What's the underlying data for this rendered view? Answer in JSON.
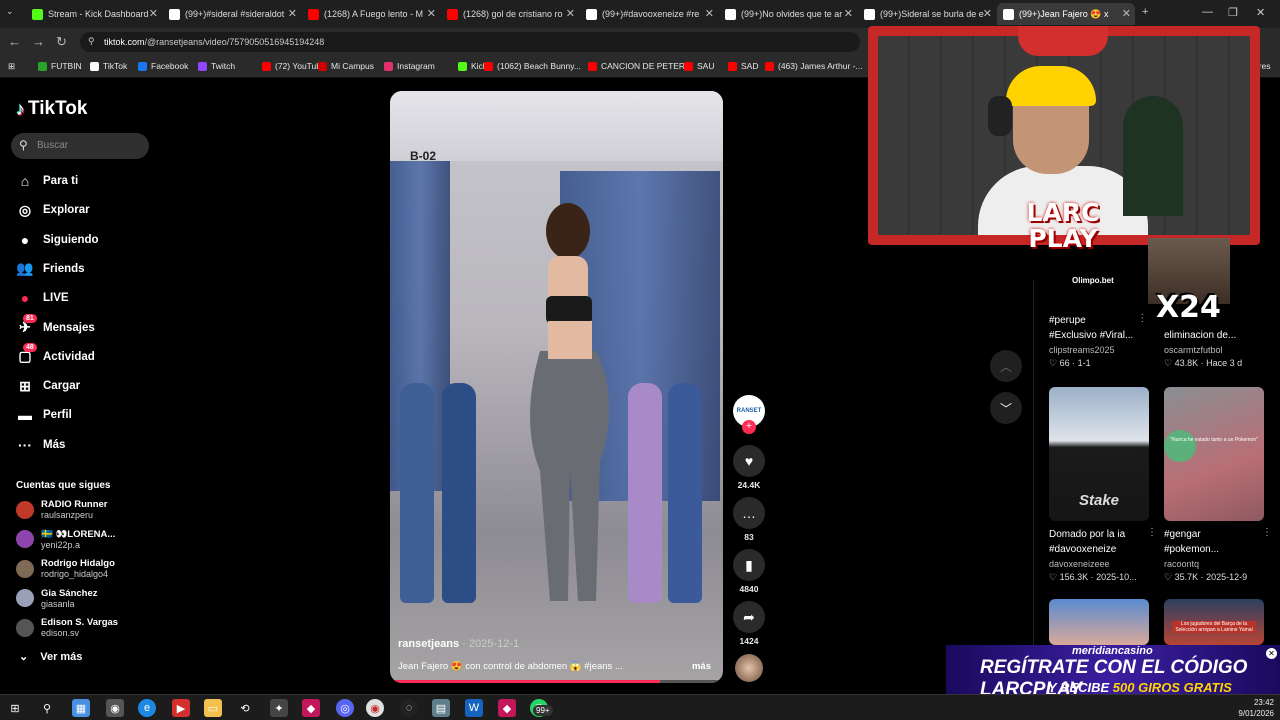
{
  "browser": {
    "tabs": [
      {
        "title": "Stream - Kick Dashboard",
        "fav": "#53fc18"
      },
      {
        "title": "(99+)#sideral #sideraldot",
        "fav": "#fff"
      },
      {
        "title": "(1268) A Fuego lento - M",
        "fav": "#ff0000"
      },
      {
        "title": "(1268) gol de cristiano ro",
        "fav": "#ff0000"
      },
      {
        "title": "(99+)#davooxeneize #re",
        "fav": "#fff"
      },
      {
        "title": "(99+)No olvides que te ar",
        "fav": "#fff"
      },
      {
        "title": "(99+)Sideral se burla de e",
        "fav": "#fff"
      },
      {
        "title": "(99+)Jean Fajero 😍 x",
        "fav": "#fff",
        "active": true
      }
    ],
    "new_tab": "+",
    "url_host": "tiktok.com",
    "url_path": "/@ransetjeans/video/7579050516945194248",
    "bookmarks": [
      {
        "label": "FUTBIN",
        "color": "#29a329"
      },
      {
        "label": "TikTok",
        "color": "#fff"
      },
      {
        "label": "Facebook",
        "color": "#1877f2"
      },
      {
        "label": "Twitch",
        "color": "#9146ff"
      },
      {
        "label": "(72) YouTube",
        "color": "#ff0000"
      },
      {
        "label": "Mi Campus",
        "color": "#c00"
      },
      {
        "label": "Instagram",
        "color": "#e1306c"
      },
      {
        "label": "Kick",
        "color": "#53fc18"
      },
      {
        "label": "(1062) Beach Bunny...",
        "color": "#ff0000"
      },
      {
        "label": "CANCION DE PETER",
        "color": "#ff0000"
      },
      {
        "label": "SAU",
        "color": "#ff0000"
      },
      {
        "label": "SAD",
        "color": "#ff0000"
      },
      {
        "label": "(463) James Arthur -...",
        "color": "#ff0000"
      }
    ],
    "bookmarks_more": "ores"
  },
  "tiktok": {
    "logo": "TikTok",
    "search_placeholder": "Buscar",
    "nav": [
      {
        "label": "Para ti",
        "icon": "home-icon",
        "glyph": "⌂"
      },
      {
        "label": "Explorar",
        "icon": "compass-icon",
        "glyph": "◎"
      },
      {
        "label": "Siguiendo",
        "icon": "following-icon",
        "glyph": "●"
      },
      {
        "label": "Friends",
        "icon": "friends-icon",
        "glyph": "👥"
      },
      {
        "label": "LIVE",
        "icon": "live-icon",
        "glyph": "●"
      },
      {
        "label": "Mensajes",
        "icon": "messages-icon",
        "glyph": "✈",
        "badge": "81"
      },
      {
        "label": "Actividad",
        "icon": "activity-icon",
        "glyph": "▢",
        "badge": "48"
      },
      {
        "label": "Cargar",
        "icon": "upload-icon",
        "glyph": "⊞"
      },
      {
        "label": "Perfil",
        "icon": "profile-icon",
        "glyph": "▬"
      },
      {
        "label": "Más",
        "icon": "more-icon",
        "glyph": "···"
      }
    ],
    "following_heading": "Cuentas que sigues",
    "following": [
      {
        "name": "RADIO Runner",
        "handle": "raulsanzperu",
        "color": "#c0392b"
      },
      {
        "name": "🇸🇪 👀LORENA...",
        "handle": "yeni22p.a",
        "color": "#8e44ad"
      },
      {
        "name": "Rodrigo Hidalgo",
        "handle": "rodrigo_hidalgo4",
        "color": "#7f6a55"
      },
      {
        "name": "Gia Sánchez",
        "handle": "giasanla",
        "color": "#9aa0b5"
      },
      {
        "name": "Edison S. Vargas",
        "handle": "edison.sv",
        "color": "#555"
      }
    ],
    "see_more": "Ver más",
    "video": {
      "store_sign": "B-02",
      "author": "ransetjeans",
      "date": "· 2025-12-1",
      "caption": "Jean Fajero 😍 con control de abdomen 😱 #jeans ...",
      "more": "más",
      "progress": 0.81
    },
    "actions": {
      "avatar_text": "RANSET",
      "likes": "24.4K",
      "comments": "83",
      "saves": "4840",
      "shares": "1424"
    },
    "recommended": [
      {
        "title1": "#perupe",
        "title2": "#Exclusivo #Viral...",
        "user": "clipstreams2025",
        "stats": "♡ 66 · 1-1"
      },
      {
        "title1": "",
        "title2": "eliminacion de...",
        "user": "oscarmtzfutbol",
        "stats": "♡ 43.8K · Hace 3 d"
      },
      {
        "title1": "Domado por la ia",
        "title2": "#davooxeneize",
        "user": "davoxeneizeee",
        "stats": "♡ 156.3K · 2025-10..."
      },
      {
        "title1": "#gengar",
        "title2": "#pokemon...",
        "user": "racoontq",
        "stats": "♡ 35.7K · 2025-12-9"
      }
    ],
    "card_text_stake": "Stake",
    "card_text_pokemon": "\"Nunca he estado tanto a un Pokemon\"",
    "card_text_barca": "Los jugadores del Barça de la Selección arropan a Lamine Yamal"
  },
  "stream_overlay": {
    "brand": "LARC PLAY",
    "sponsor": "Olimpo.bet",
    "multiplier": "X24",
    "casino_head": "meridiancasino",
    "casino_line1": "REGÍTRATE CON EL CÓDIGO  LARCPLAY",
    "casino_line2_a": "Y RECIBE ",
    "casino_line2_b": "500 GIROS GRATIS"
  },
  "taskbar": {
    "badge": "99+",
    "date": "9/01/2026",
    "time": "23:42"
  }
}
